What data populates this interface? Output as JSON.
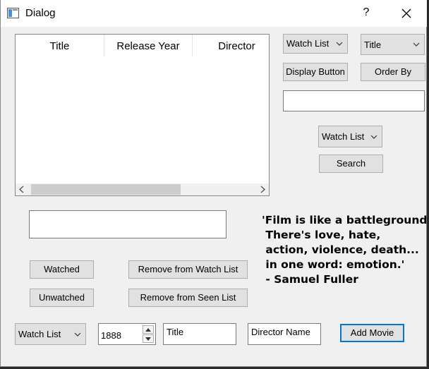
{
  "window": {
    "title": "Dialog",
    "help_label": "?"
  },
  "table": {
    "columns": [
      "Title",
      "Release Year",
      "Director"
    ]
  },
  "top_right": {
    "list_combo_value": "Watch List",
    "sort_combo_value": "Title",
    "display_button_label": "Display Button",
    "order_by_button_label": "Order By",
    "search_value": "",
    "search_list_combo_value": "Watch List",
    "search_button_label": "Search"
  },
  "detail_value": "",
  "buttons": {
    "watched": "Watched",
    "unwatched": "Unwatched",
    "remove_watch": "Remove from Watch List",
    "remove_seen": "Remove from Seen List",
    "add_movie": "Add Movie"
  },
  "quote": "'Film is like a battleground.\n There's love, hate,\n action, violence, death...\n in one word: emotion.'\n - Samuel Fuller",
  "add_form": {
    "list_combo_value": "Watch List",
    "year_value": "1888",
    "title_value": "Title",
    "director_value": "Director Name"
  },
  "icons": {
    "app": "app-window-icon",
    "close": "close-icon",
    "chevron": "chevron-down-icon"
  },
  "colors": {
    "default_button_border": "#0078d7"
  }
}
